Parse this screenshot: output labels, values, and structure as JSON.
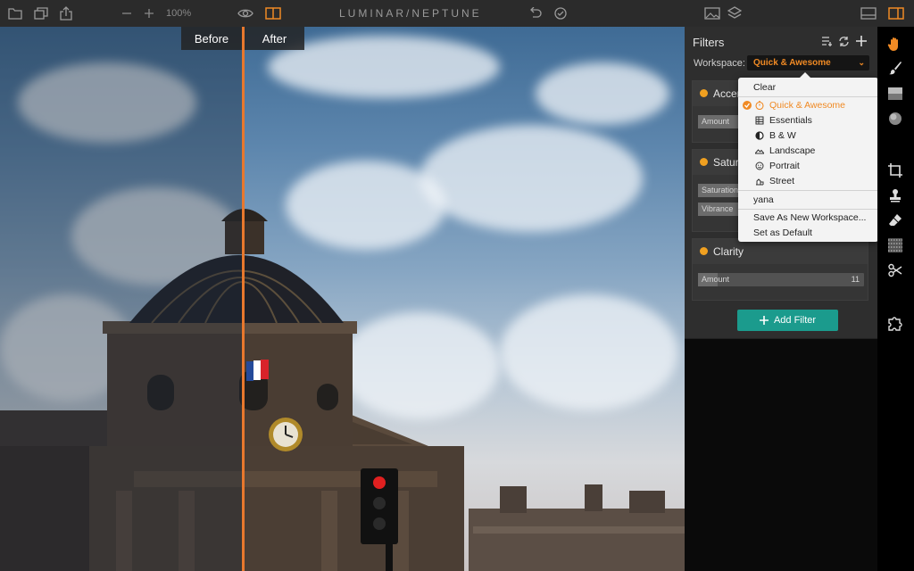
{
  "app_title": "LUMINAR/NEPTUNE",
  "toolbar": {
    "zoom": "100%",
    "icons": [
      "folder-icon",
      "batch-icon",
      "share-icon",
      "zoom-out-icon",
      "zoom-in-icon",
      "eye-icon",
      "compare-icon",
      "undo-icon",
      "history-icon",
      "image-icon",
      "layers-icon",
      "filmstrip-icon",
      "sidebar-icon"
    ]
  },
  "compare": {
    "before": "Before",
    "after": "After"
  },
  "filters_panel": {
    "title": "Filters",
    "workspace_label": "Workspace:",
    "workspace_value": "Quick & Awesome",
    "cards": [
      {
        "title": "Accen",
        "sliders": [
          {
            "label": "Amount",
            "value": ""
          }
        ]
      },
      {
        "title": "Satura",
        "sliders": [
          {
            "label": "Saturation",
            "value": ""
          },
          {
            "label": "Vibrance",
            "value": ""
          }
        ]
      },
      {
        "title": "Clarity",
        "sliders": [
          {
            "label": "Amount",
            "value": "11"
          }
        ]
      }
    ],
    "add_filter": "Add Filter"
  },
  "dropdown": {
    "clear": "Clear",
    "workspaces": [
      {
        "label": "Quick & Awesome",
        "icon": "stopwatch-icon",
        "selected": true
      },
      {
        "label": "Essentials",
        "icon": "grid-icon",
        "selected": false
      },
      {
        "label": "B & W",
        "icon": "contrast-icon",
        "selected": false
      },
      {
        "label": "Landscape",
        "icon": "mountain-icon",
        "selected": false
      },
      {
        "label": "Portrait",
        "icon": "face-icon",
        "selected": false
      },
      {
        "label": "Street",
        "icon": "street-icon",
        "selected": false
      }
    ],
    "user": "yana",
    "save_as": "Save As New Workspace...",
    "set_default": "Set as Default"
  },
  "colors": {
    "accent": "#f08a24",
    "teal": "#1b9b8d",
    "split": "#e8782d"
  }
}
